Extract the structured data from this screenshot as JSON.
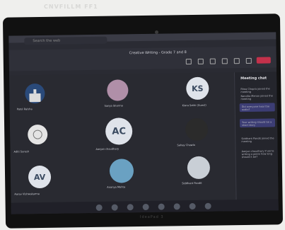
{
  "photo": {
    "header_text": "CNVFILLM FF1",
    "bezel_brand": "IdeaPad 3"
  },
  "teams_window": {
    "search_placeholder": "Search the web",
    "meeting_title": "Creative Writing - Grade 7 and 8",
    "chat_panel_title": "Meeting chat"
  },
  "participants": [
    {
      "name": "Patel Raisha",
      "initials": "",
      "avatar": "castle"
    },
    {
      "name": "Sanya Sharma",
      "initials": "",
      "avatar": "photo"
    },
    {
      "name": "Kiara Sethi (Guest)",
      "initials": "KS",
      "avatar": "initials"
    },
    {
      "name": "Aditi Suresh",
      "initials": "",
      "avatar": "ornament"
    },
    {
      "name": "Aanjan choudhary",
      "initials": "AC",
      "avatar": "initials"
    },
    {
      "name": "Sahay Chawla",
      "initials": "",
      "avatar": "photo-dark"
    },
    {
      "name": "Aarav Vishwakarma",
      "initials": "AV",
      "avatar": "initials"
    },
    {
      "name": "Ananya Mehta",
      "initials": "",
      "avatar": "landscape"
    },
    {
      "name": "Siddhant Pandit",
      "initials": "",
      "avatar": "photo"
    }
  ],
  "chat": [
    {
      "sender": "Rhea Chopra",
      "text": "joined the meeting"
    },
    {
      "sender": "Nandita Menon",
      "text": "joined the meeting"
    },
    {
      "sender": "",
      "text": "Did everyone hear the audio?"
    },
    {
      "sender": "",
      "text": "Your writing should be a short story"
    },
    {
      "sender": "Siddhant Pandit",
      "text": "joined the meeting"
    },
    {
      "sender": "Aanjan choudhary",
      "text": "If we're writing a poem how long should it be?"
    }
  ],
  "colors": {
    "app_background": "#2a2b33",
    "leave_button": "#c4314b",
    "chat_bubble": "#3c3d74"
  }
}
